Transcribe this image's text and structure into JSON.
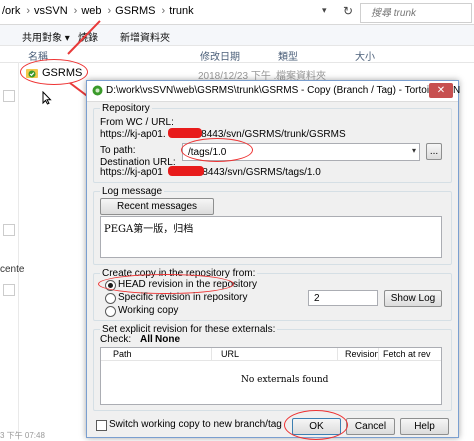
{
  "explorer": {
    "breadcrumbs": [
      "/ork",
      "vsSVN",
      "web",
      "GSRMS",
      "trunk"
    ],
    "search_placeholder": "搜尋 trunk",
    "toolbar": [
      "共用對象 ▾",
      "燒錄",
      "新增資料夾"
    ],
    "columns": {
      "name": "名稱",
      "date": "修改日期",
      "type": "類型",
      "size": "大小"
    },
    "row": {
      "name": "GSRMS",
      "date": "2018/12/23 下午 ...",
      "type": "檔案資料夾"
    },
    "left_text": "cente",
    "status": "3 下午 07:48"
  },
  "dialog": {
    "title": "D:\\work\\vsSVN\\web\\GSRMS\\trunk\\GSRMS - Copy (Branch / Tag) - TortoiseSVN",
    "close": "✕",
    "repository_label": "Repository",
    "from_label": "From WC / URL:",
    "from_url_prefix": "https://kj-ap01.",
    "from_url_suffix": "t:8443/svn/GSRMS/trunk/GSRMS",
    "to_path_label": "To path:",
    "to_path_value": "/tags/1.0",
    "browse_btn": "...",
    "dest_label": "Destination URL:",
    "dest_url_prefix": "https://kj-ap01",
    "dest_url_suffix": "t:8443/svn/GSRMS/tags/1.0",
    "log_label": "Log message",
    "recent_btn": "Recent messages",
    "log_text": "PEGA第一版，归档",
    "create_copy_label": "Create copy in the repository from:",
    "radio_head": "HEAD revision in the repository",
    "radio_specific": "Specific revision in repository",
    "radio_wc": "Working copy",
    "revision_value": "2",
    "show_log_btn": "Show Log",
    "externals_label": "Set explicit revision for these externals:",
    "check_label": "Check:",
    "check_all": "All",
    "check_none": "None",
    "ext_columns": [
      "Path",
      "URL",
      "Revision",
      "Fetch at rev"
    ],
    "no_externals": "No externals found",
    "switch_label": "Switch working copy to new branch/tag",
    "ok_btn": "OK",
    "cancel_btn": "Cancel",
    "help_btn": "Help"
  },
  "colors": {
    "annotation": "#e33333",
    "redaction": "#e81b1b",
    "svn_green": "#3a9a2a"
  }
}
